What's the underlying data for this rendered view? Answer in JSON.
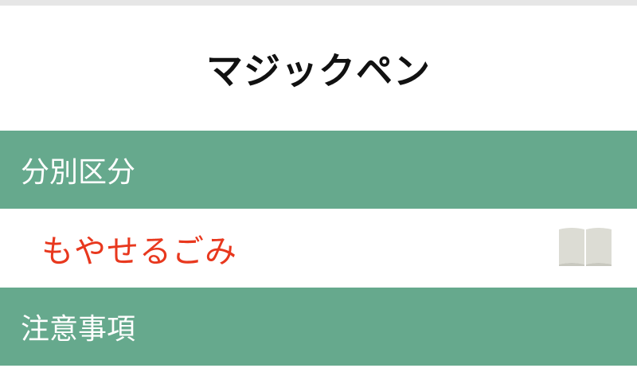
{
  "item": {
    "title": "マジックペン"
  },
  "sections": {
    "category_header": "分別区分",
    "category_value": "もやせるごみ",
    "notes_header": "注意事項"
  },
  "icons": {
    "guide": "book-icon"
  },
  "colors": {
    "header_bg": "#66a98d",
    "category_text": "#e8381e",
    "icon": "#dcdcd4"
  }
}
